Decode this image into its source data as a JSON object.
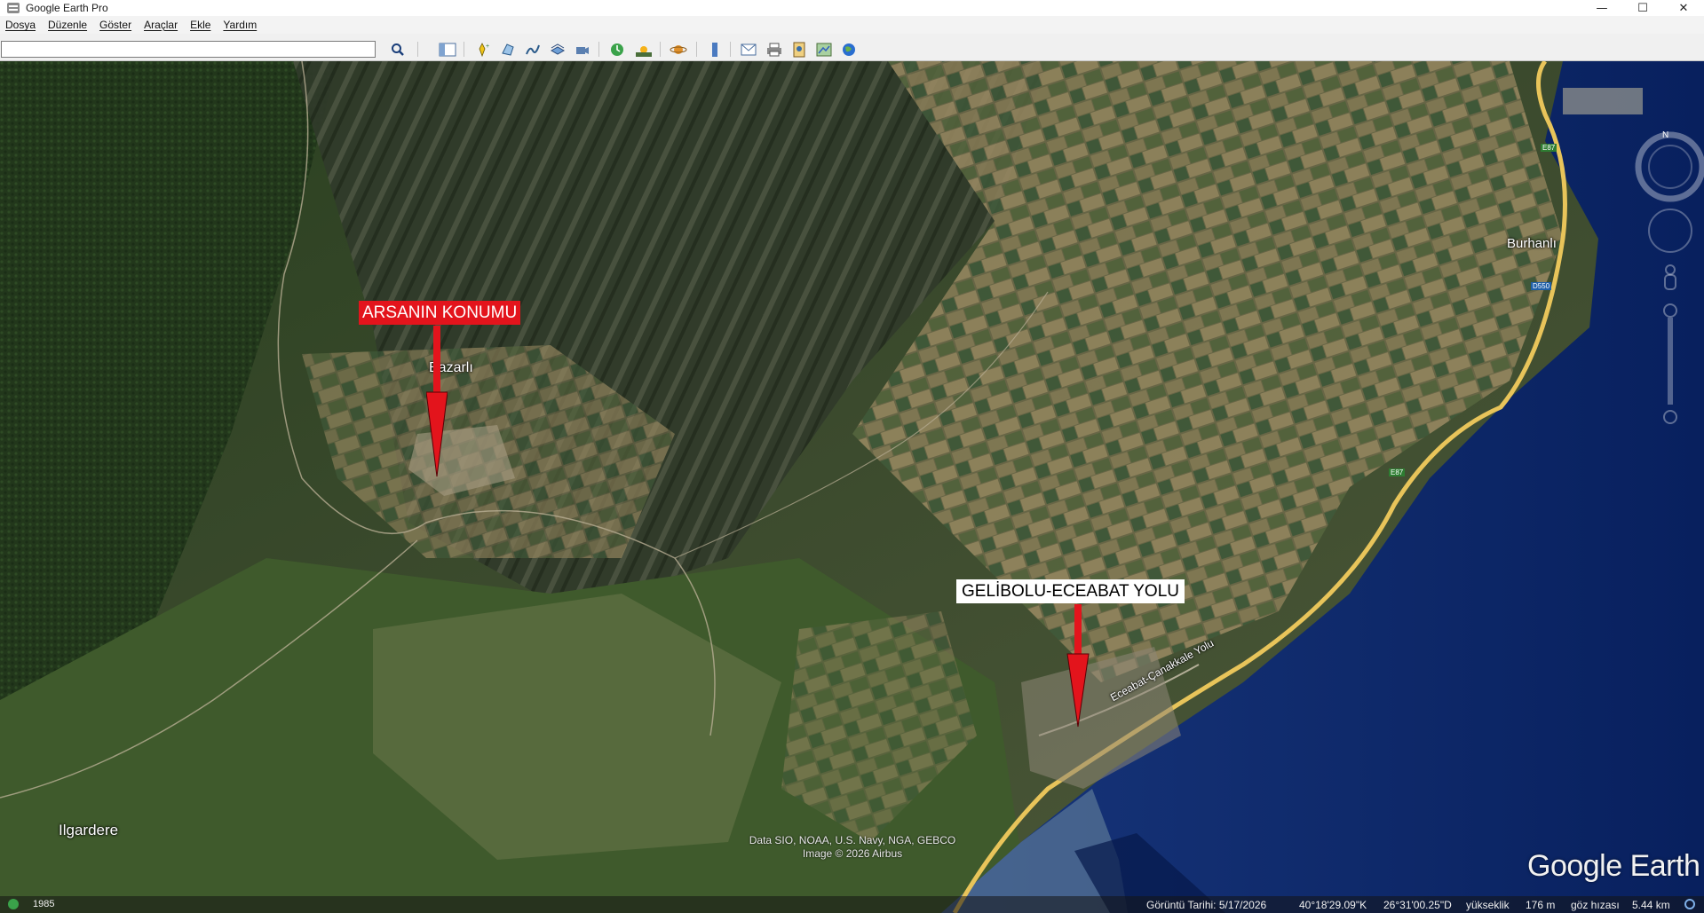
{
  "window": {
    "title": "Google Earth Pro",
    "controls": {
      "minimize": "—",
      "maximize": "☐",
      "close": "✕"
    }
  },
  "menu": {
    "items": [
      "Dosya",
      "Düzenle",
      "Göster",
      "Araçlar",
      "Ekle",
      "Yardım"
    ]
  },
  "toolbar": {
    "search": {
      "value": "",
      "placeholder": ""
    },
    "buttons": [
      "search-icon",
      "sidebar-icon",
      "placemark-icon",
      "polygon-icon",
      "path-icon",
      "image-overlay-icon",
      "record-tour-icon",
      "historical-imagery-icon",
      "sunlight-icon",
      "planets-icon",
      "ruler-icon",
      "email-icon",
      "print-icon",
      "save-image-icon",
      "view-in-maps-icon",
      "earth-gallery-icon"
    ]
  },
  "map": {
    "places": {
      "bazarli": "Bazarlı",
      "burhanli": "Burhanlı",
      "ilgardere": "Ilgardere",
      "road_name": "Eceabat-Çanakkale Yolu",
      "shield_e87_top": "E87",
      "shield_d550": "D550",
      "shield_e87_mid": "E87"
    },
    "callouts": {
      "plot_location": "ARSANIN KONUMU",
      "road": "GELİBOLU-ECEABAT YOLU"
    },
    "attribution": {
      "line1": "Data SIO, NOAA, U.S. Navy, NGA, GEBCO",
      "line2": "Image © 2026 Airbus"
    },
    "logo": "Google Earth",
    "compass_letter": "N"
  },
  "status": {
    "year": "1985",
    "imagery_date": "Görüntü Tarihi: 5/17/2026",
    "lat": "40°18'29.09\"K",
    "lon": "26°31'00.25\"D",
    "elevation_label": "yükseklik",
    "elevation": "176 m",
    "eye_label": "göz hızası",
    "eye_alt": "5.44 km"
  },
  "colors": {
    "callout_red": "#e3141c",
    "sea": "#0b2a6b",
    "highway": "#e8c45a"
  }
}
